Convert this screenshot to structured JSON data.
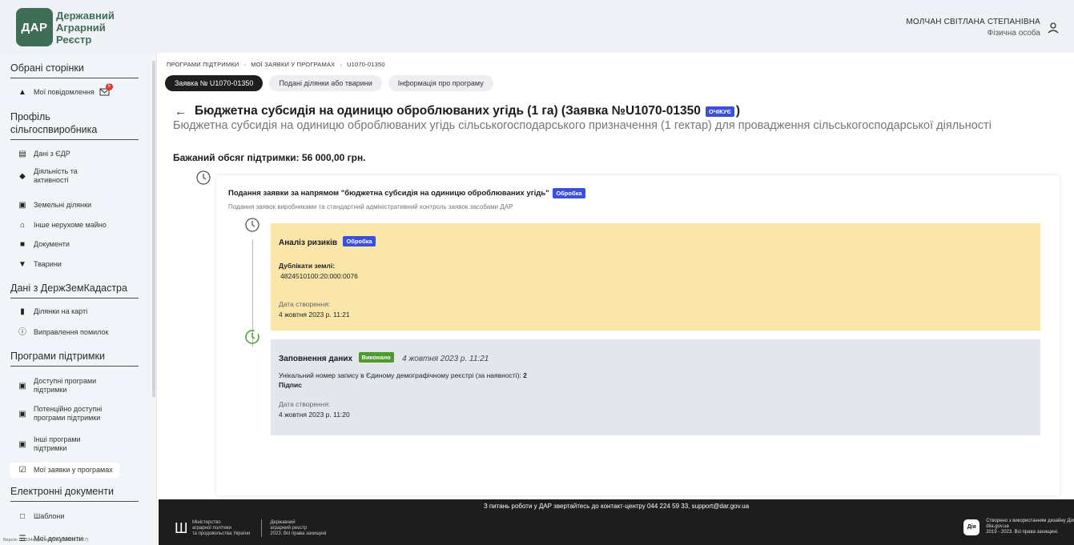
{
  "header": {
    "logo_abbr": "ДАР",
    "logo_line1": "Державний",
    "logo_line2": "Аграрний",
    "logo_line3": "Реєстр",
    "user_name": "МОЛЧАН СВІТЛАНА СТЕПАНІВНА",
    "user_role": "Фізична особа"
  },
  "sidebar": {
    "sections": {
      "favorites": "Обрані сторінки",
      "profile": "Профіль сільгоспвиробника",
      "cadastre": "Дані з ДержЗемКадастра",
      "programs": "Програми підтримки",
      "documents": "Електронні документи"
    },
    "items": {
      "notifications": "Мої повідомлення",
      "notifications_count": "5",
      "edr": "Дані з ЄДР",
      "activity_l1": "Діяльність та",
      "activity_l2": "активності",
      "land": "Земельні ділянки",
      "property": "Інше нерухоме майно",
      "docs": "Документи",
      "animals": "Тварини",
      "map": "Ділянки на карті",
      "errors": "Виправлення помилок",
      "available_l1": "Доступні програми",
      "available_l2": "підтримки",
      "potential_l1": "Потенційно доступні",
      "potential_l2": "програми підтримки",
      "other_l1": "Інші програми",
      "other_l2": "підтримки",
      "my_applications": "Мої заявки у програмах",
      "templates": "Шаблони",
      "my_documents": "Мої документи"
    },
    "version": "Версія: 00f534ef-perfect(17.10.2023 18:27)"
  },
  "breadcrumb": {
    "item1": "ПРОГРАМИ ПІДТРИМКИ",
    "item2": "МОЇ ЗАЯВКИ У ПРОГРАМАХ",
    "item3": "U1070-01350"
  },
  "tabs": {
    "tab1": "Заявка № U1070-01350",
    "tab2": "Подані ділянки або тварини",
    "tab3": "Інформація про програму"
  },
  "page": {
    "title": "Бюджетна субсидія на одиницю оброблюваних угідь (1 га) (Заявка №U1070-01350",
    "title_badge": "ОЧІКУЄ",
    "title_close": ")",
    "subtitle": "Бюджетна субсидія на одиницю оброблюваних угідь сільськогосподарського призначення (1 гектар) для провадження сільськогосподарської діяльності",
    "amount": "Бажаний обсяг підтримки: 56 000,00 грн."
  },
  "card": {
    "title": "Подання заявки за напрямом \"бюджетна субсидія на одиницю оброблюваних угідь\"",
    "title_badge": "Обробка",
    "subtitle": "Подання заявок виробниками та стандартний адміністративний контроль заявок засобами ДАР",
    "step1": {
      "title": "Аналіз ризиків",
      "badge": "Обробка",
      "dup_label": "Дублікати землі:",
      "dup_value": "4824510100:20:000:0076",
      "created_label": "Дата створення:",
      "created_value": "4 жовтня 2023 р. 11:21"
    },
    "step2": {
      "title": "Заповнення даних",
      "badge": "Виконано",
      "date": "4 жовтня 2023 р. 11:21",
      "line1": "Унікальний номер запису в Єдиному демографічному реєстрі (за наявності):",
      "line1_value": "2",
      "line2": "Підпис",
      "created_label": "Дата створення:",
      "created_value": "4 жовтня 2023 р. 11:20"
    }
  },
  "footer": {
    "contact": "З питань роботи у ДАР звертайтесь до контакт-центру 044 224 59 33, support@dar.gov.ua",
    "min_l1": "Міністерство",
    "min_l2": "аграрної політики",
    "min_l3": "та продовольства України",
    "reg_l1": "Державний",
    "reg_l2": "аграрний реєстр",
    "reg_l3": "2023. Всі права захищені",
    "diia": "Дія",
    "right_l1": "Створено з використанням дизайну Дія",
    "right_l2": "diia.gov.ua",
    "right_l3": "2019 - 2023. Всі права захищені."
  }
}
